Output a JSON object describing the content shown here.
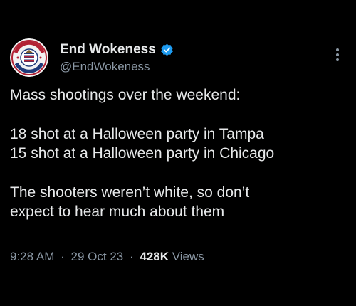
{
  "author": {
    "display_name": "End Wokeness",
    "handle": "@EndWokeness",
    "avatar_icon": "eagle-badge-avatar-icon",
    "verified_icon": "verified-badge-icon",
    "verified_color": "#1d9bf0"
  },
  "tweet": {
    "line1": "Mass shootings over the weekend:",
    "line2": "18 shot at a Halloween party in Tampa",
    "line3": "15 shot at a Halloween party in Chicago",
    "line4": "The shooters weren’t white, so don’t",
    "line5": "expect to hear much about them"
  },
  "meta": {
    "time": "9:28 AM",
    "separator": "·",
    "date": "29 Oct 23",
    "views_count": "428K",
    "views_label": "Views"
  },
  "colors": {
    "background": "#000000",
    "primary_text": "#e7e9ea",
    "secondary_text": "#8b98a5"
  }
}
